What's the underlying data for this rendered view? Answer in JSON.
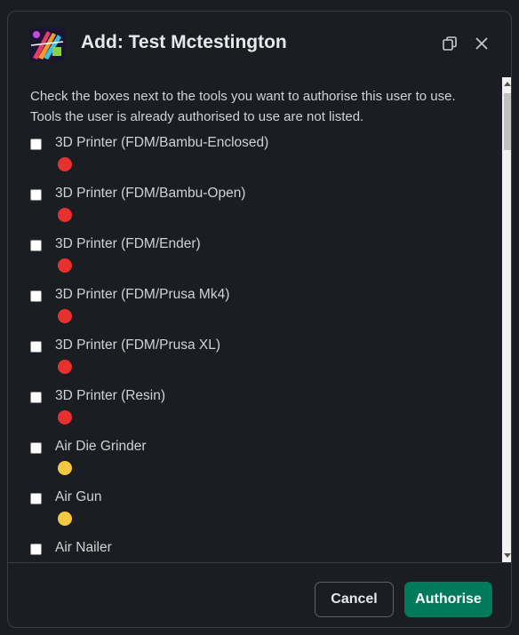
{
  "modal": {
    "title": "Add: Test Mctestington",
    "intro": "Check the boxes next to the tools you want to authorise this user to use. Tools the user is already authorised to use are not listed.",
    "popout_icon": "popout-window-icon",
    "close_icon": "close-icon"
  },
  "tools": [
    {
      "name": "3D Printer (FDM/Bambu-Enclosed)",
      "checked": false,
      "status_color": "#e8312f"
    },
    {
      "name": "3D Printer (FDM/Bambu-Open)",
      "checked": false,
      "status_color": "#e8312f"
    },
    {
      "name": "3D Printer (FDM/Ender)",
      "checked": false,
      "status_color": "#e8312f"
    },
    {
      "name": "3D Printer (FDM/Prusa Mk4)",
      "checked": false,
      "status_color": "#e8312f"
    },
    {
      "name": "3D Printer (FDM/Prusa XL)",
      "checked": false,
      "status_color": "#e8312f"
    },
    {
      "name": "3D Printer (Resin)",
      "checked": false,
      "status_color": "#e8312f"
    },
    {
      "name": "Air Die Grinder",
      "checked": false,
      "status_color": "#f5c842"
    },
    {
      "name": "Air Gun",
      "checked": false,
      "status_color": "#f5c842"
    },
    {
      "name": "Air Nailer",
      "checked": false,
      "status_color": "#f5c842"
    }
  ],
  "footer": {
    "cancel_label": "Cancel",
    "authorise_label": "Authorise"
  },
  "colors": {
    "primary_button": "#007a5a",
    "background": "#1a1d21"
  }
}
